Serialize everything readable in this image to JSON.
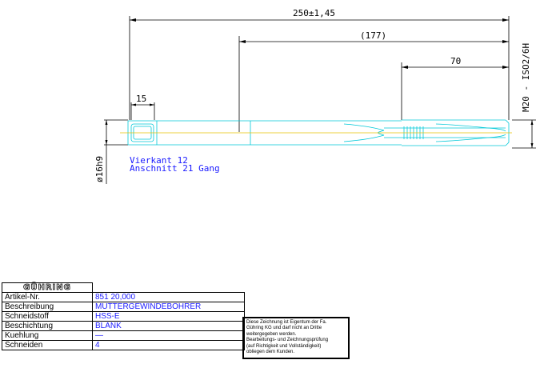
{
  "dimensions": {
    "overall_length": "250±1,45",
    "reference_length": "(177)",
    "thread_length": "70",
    "square_length": "15",
    "shank_diameter": "ø16h9",
    "thread_spec": "M20 - ISO2/6H"
  },
  "notes": {
    "line1": "Vierkant 12",
    "line2": "Anschnitt 21 Gang"
  },
  "title_block": {
    "logo": "GÜHRING",
    "rows": [
      {
        "label": "Artikel-Nr.",
        "value": "851 20,000"
      },
      {
        "label": "Beschreibung",
        "value": "MUTTERGEWINDEBOHRER"
      },
      {
        "label": "Schneidstoff",
        "value": "HSS-E"
      },
      {
        "label": "Beschichtung",
        "value": "BLANK"
      },
      {
        "label": "Kuehlung",
        "value": "—"
      },
      {
        "label": "Schneiden",
        "value": "4"
      }
    ]
  },
  "copyright_note": {
    "lines": [
      "Diese Zeichnung ist Eigentum der Fa.",
      "Gühring KG und darf nicht an Dritte",
      "weitergegeben werden.",
      "Bearbeitungs- und Zeichnungsprüfung",
      "(auf Richtigkeit und Vollständigkeit)",
      "obliegen dem Kunden."
    ]
  },
  "colors": {
    "outline": "#00c8d8",
    "centerline": "#e6c200",
    "dimension": "#000000",
    "annotation": "#1a1aff"
  }
}
